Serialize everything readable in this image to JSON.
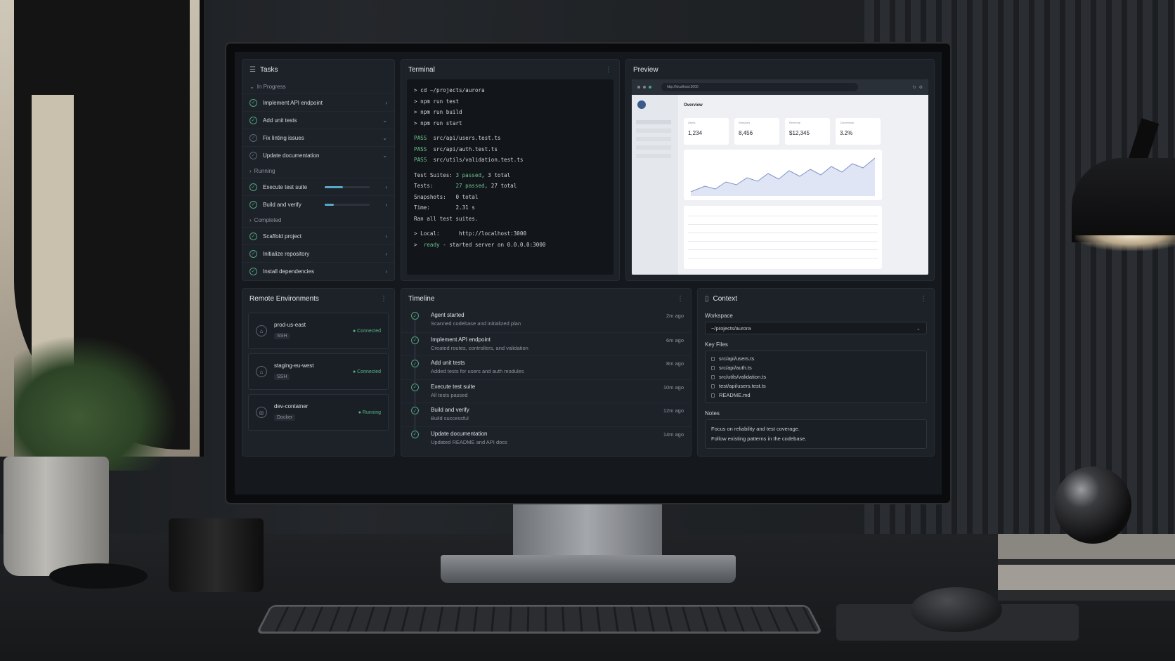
{
  "tasks": {
    "title": "Tasks",
    "groups": [
      {
        "label": "In Progress",
        "items": [
          {
            "label": "Implement API endpoint"
          },
          {
            "label": "Add unit tests"
          },
          {
            "label": "Fix linting issues"
          },
          {
            "label": "Update documentation"
          }
        ]
      },
      {
        "label": "Running",
        "items": [
          {
            "label": "Execute test suite",
            "progress": 0.4
          },
          {
            "label": "Build and verify",
            "progress": 0.2
          }
        ]
      },
      {
        "label": "Completed",
        "items": [
          {
            "label": "Scaffold project"
          },
          {
            "label": "Initialize repository"
          },
          {
            "label": "Install dependencies"
          }
        ]
      }
    ]
  },
  "terminal": {
    "title": "Terminal",
    "commands": [
      "> cd ~/projects/aurora",
      "> npm run test",
      "> npm run build",
      "> npm run start"
    ],
    "passes": [
      {
        "status": "PASS",
        "file": "src/api/users.test.ts"
      },
      {
        "status": "PASS",
        "file": "src/api/auth.test.ts"
      },
      {
        "status": "PASS",
        "file": "src/utils/validation.test.ts"
      }
    ],
    "summary": {
      "suites_label": "Test Suites:",
      "suites_passed": "3 passed",
      "suites_total": ", 3 total",
      "tests_label": "Tests:",
      "tests_passed": "27 passed",
      "tests_total": ", 27 total",
      "snapshots_label": "Snapshots:",
      "snapshots_value": "0 total",
      "time_label": "Time:",
      "time_value": "2.31 s",
      "ran": "Ran all test suites."
    },
    "local_label": "> Local:",
    "local_url": "http://localhost:3000",
    "ready_prefix": ">",
    "ready_word": "ready",
    "ready_text": "- started server on 0.0.0.0:3000"
  },
  "preview": {
    "title": "Preview",
    "url": "http://localhost:3000",
    "page_title": "Overview",
    "kpis": [
      {
        "label": "Users",
        "value": "1,234"
      },
      {
        "label": "Sessions",
        "value": "8,456"
      },
      {
        "label": "Revenue",
        "value": "$12,345"
      },
      {
        "label": "Conversion",
        "value": "3.2%"
      }
    ]
  },
  "environments": {
    "title": "Remote Environments",
    "items": [
      {
        "name": "prod-us-east",
        "type": "SSH",
        "status": "● Connected"
      },
      {
        "name": "staging-eu-west",
        "type": "SSH",
        "status": "● Connected"
      },
      {
        "name": "dev-container",
        "type": "Docker",
        "status": "● Running"
      }
    ]
  },
  "timeline": {
    "title": "Timeline",
    "events": [
      {
        "title": "Agent started",
        "sub": "Scanned codebase and initialized plan",
        "time": "2m ago"
      },
      {
        "title": "Implement API endpoint",
        "sub": "Created routes, controllers, and validation",
        "time": "6m ago"
      },
      {
        "title": "Add unit tests",
        "sub": "Added tests for users and auth modules",
        "time": "8m ago"
      },
      {
        "title": "Execute test suite",
        "sub": "All tests passed",
        "time": "10m ago"
      },
      {
        "title": "Build and verify",
        "sub": "Build successful",
        "time": "12m ago"
      },
      {
        "title": "Update documentation",
        "sub": "Updated README and API docs",
        "time": "14m ago"
      }
    ]
  },
  "context": {
    "title": "Context",
    "workspace_label": "Workspace",
    "workspace_value": "~/projects/aurora",
    "key_files_label": "Key Files",
    "files": [
      "src/api/users.ts",
      "src/api/auth.ts",
      "src/utils/validation.ts",
      "test/api/users.test.ts",
      "README.md"
    ],
    "notes_label": "Notes",
    "notes": [
      "Focus on reliability and test coverage.",
      "Follow existing patterns in the codebase."
    ]
  },
  "colors": {
    "accent_green": "#4fa37f",
    "progress_blue": "#5aa8c8",
    "panel_bg": "#1d2229"
  }
}
